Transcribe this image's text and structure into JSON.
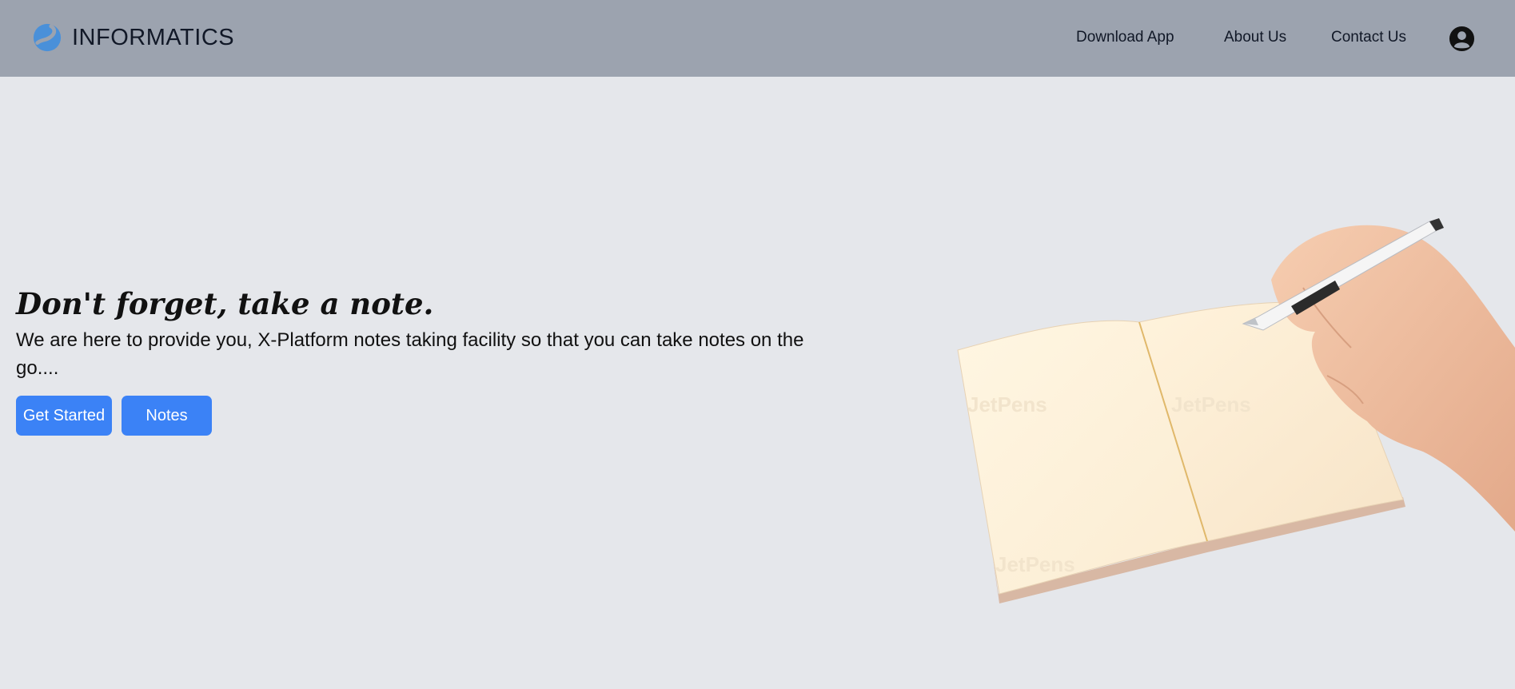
{
  "brand": {
    "name": "INFORMATICS",
    "logo_icon": "brand-swirl-icon"
  },
  "nav": {
    "download_label": "Download App",
    "about_label": "About Us",
    "contact_label": "Contact Us",
    "user_icon": "user-circle-icon"
  },
  "hero": {
    "title": "Don't forget, take a note.",
    "subtitle": "We are here to provide you, X-Platform notes taking facility so that you can take notes on the go....",
    "get_started_label": "Get Started",
    "notes_label": "Notes",
    "image_icon": "hand-writing-notebook-icon",
    "watermark": "JetPens"
  },
  "colors": {
    "navbar": "#9ca3af",
    "background": "#e5e7eb",
    "primary_button": "#3b82f6",
    "text": "#111827"
  }
}
